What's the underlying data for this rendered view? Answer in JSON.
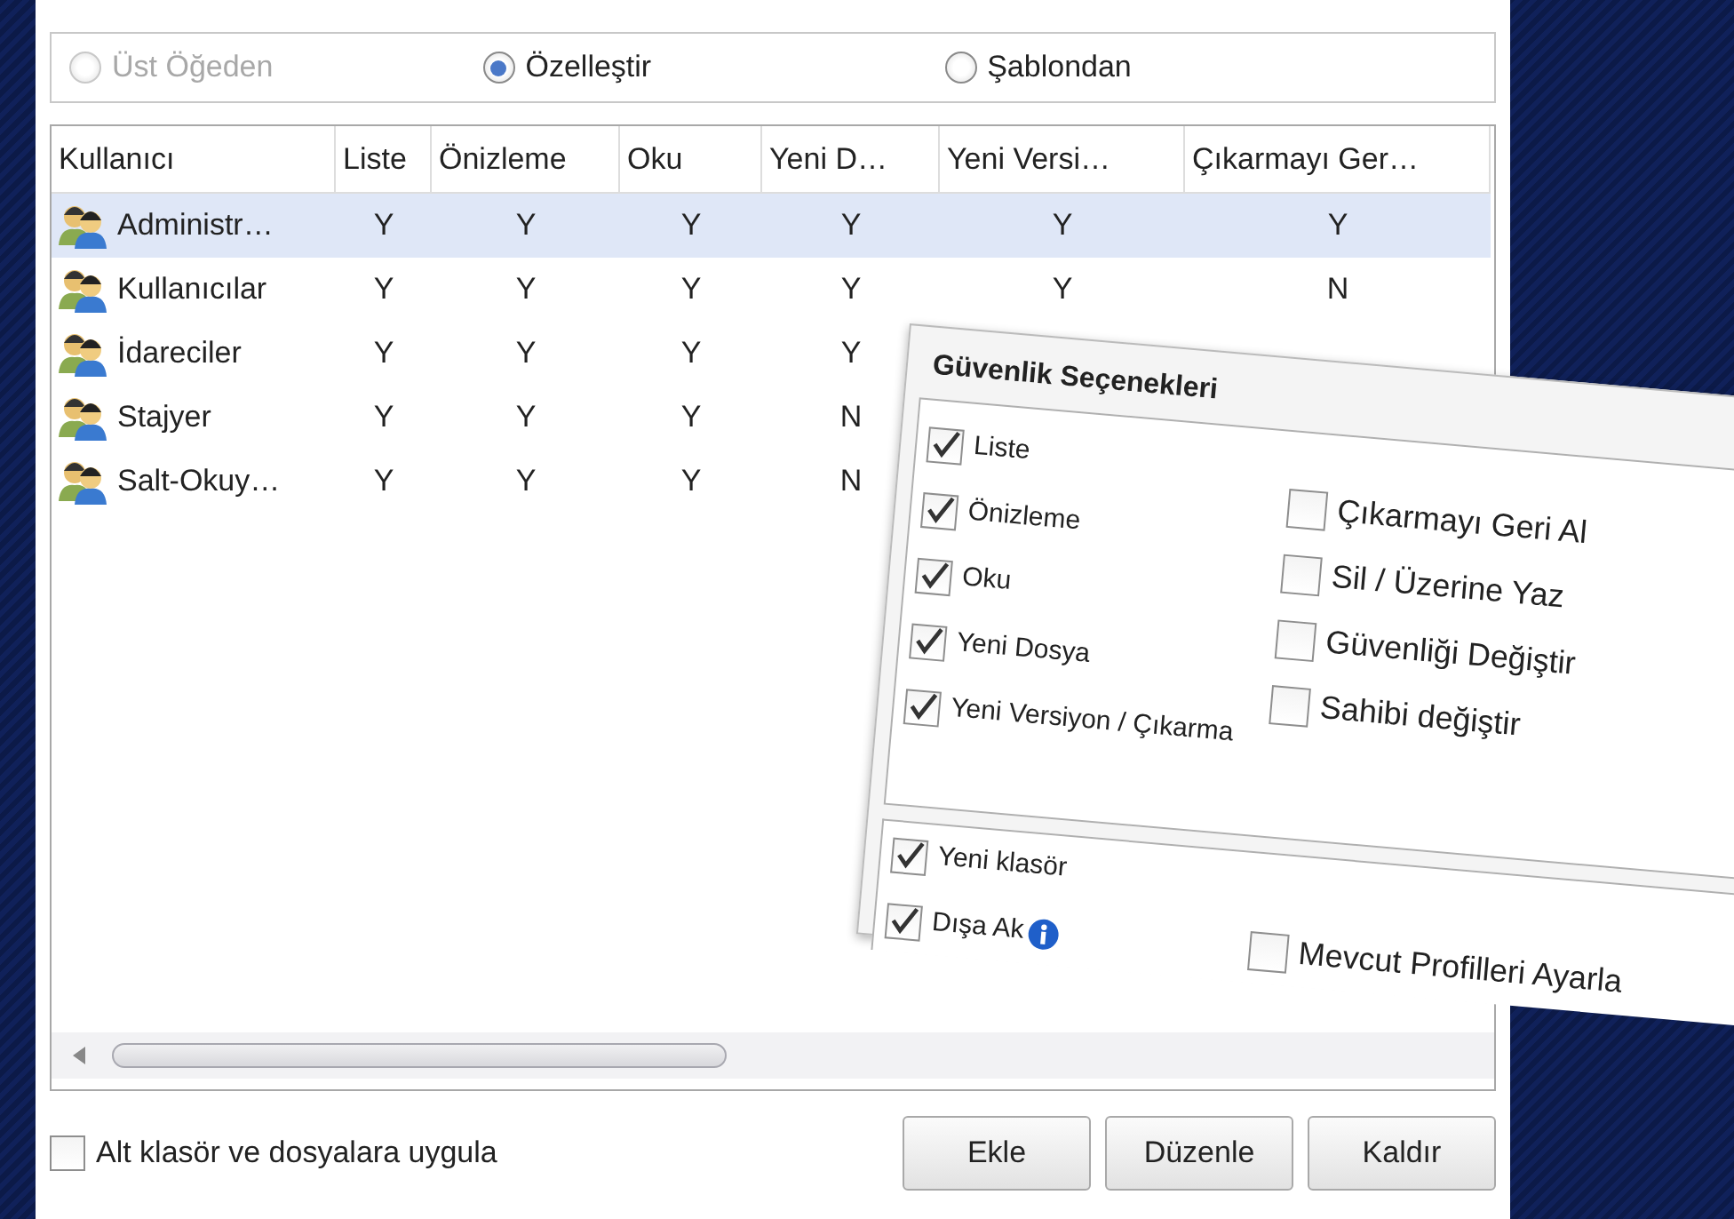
{
  "source_options": [
    {
      "label": "Üst Öğeden",
      "selected": false,
      "disabled": true
    },
    {
      "label": "Özelleştir",
      "selected": true,
      "disabled": false
    },
    {
      "label": "Şablondan",
      "selected": false,
      "disabled": false
    }
  ],
  "table": {
    "columns": [
      "Kullanıcı",
      "Liste",
      "Önizleme",
      "Oku",
      "Yeni D…",
      "Yeni Versi…",
      "Çıkarmayı Ger…"
    ],
    "rows": [
      {
        "selected": true,
        "cells": [
          "Administr…",
          "Y",
          "Y",
          "Y",
          "Y",
          "Y",
          "Y"
        ]
      },
      {
        "selected": false,
        "cells": [
          "Kullanıcılar",
          "Y",
          "Y",
          "Y",
          "Y",
          "Y",
          "N"
        ]
      },
      {
        "selected": false,
        "cells": [
          "İdareciler",
          "Y",
          "Y",
          "Y",
          "Y"
        ]
      },
      {
        "selected": false,
        "cells": [
          "Stajyer",
          "Y",
          "Y",
          "Y",
          "N"
        ]
      },
      {
        "selected": false,
        "cells": [
          "Salt-Okuy…",
          "Y",
          "Y",
          "Y",
          "N"
        ]
      }
    ]
  },
  "apply_to_children": {
    "label": "Alt klasör ve dosyalara uygula",
    "checked": false
  },
  "buttons": [
    "Ekle",
    "Düzenle",
    "Kaldır"
  ],
  "security_panel": {
    "title": "Güvenlik Seçenekleri",
    "permissions_left": [
      {
        "label": "Liste",
        "checked": true
      },
      {
        "label": "Önizleme",
        "checked": true
      },
      {
        "label": "Oku",
        "checked": true
      },
      {
        "label": "Yeni Dosya",
        "checked": true
      },
      {
        "label": "Yeni Versiyon / Çıkarma",
        "checked": true
      }
    ],
    "permissions_right": [
      {
        "label": "Çıkarmayı Geri Al",
        "checked": false
      },
      {
        "label": "Sil / Üzerine Yaz",
        "checked": false
      },
      {
        "label": "Güvenliği Değiştir",
        "checked": false
      },
      {
        "label": "Sahibi değiştir",
        "checked": false
      }
    ],
    "folder_options": [
      {
        "label": "Yeni klasör",
        "checked": true,
        "info": false
      },
      {
        "label": "Dışa Ak",
        "checked": true,
        "info": true
      }
    ],
    "profile_option": {
      "label": "Mevcut Profilleri Ayarla",
      "checked": false
    }
  }
}
